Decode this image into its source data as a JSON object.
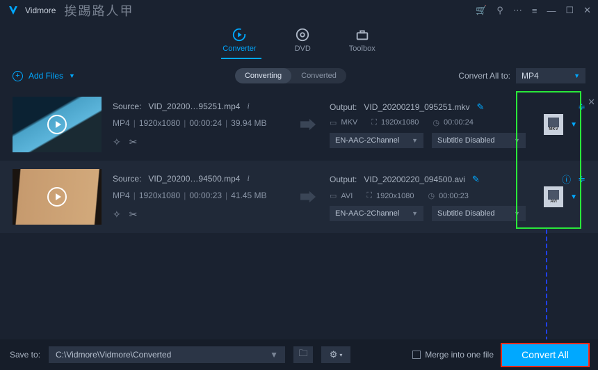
{
  "app": {
    "name": "Vidmore",
    "watermark": "挨踢路人甲"
  },
  "tabs": {
    "converter": "Converter",
    "dvd": "DVD",
    "toolbox": "Toolbox"
  },
  "toolbar": {
    "add_files": "Add Files",
    "seg_converting": "Converting",
    "seg_converted": "Converted",
    "convert_all_to": "Convert All to:",
    "convert_all_to_value": "MP4"
  },
  "items": [
    {
      "source_prefix": "Source:",
      "source_name": "VID_20200…95251.mp4",
      "format": "MP4",
      "resolution": "1920x1080",
      "duration": "00:00:24",
      "size": "39.94 MB",
      "output_prefix": "Output:",
      "output_name": "VID_20200219_095251.mkv",
      "out_container": "MKV",
      "out_resolution": "1920x1080",
      "out_duration": "00:00:24",
      "audio": "EN-AAC-2Channel",
      "subtitle": "Subtitle Disabled",
      "badge": "MKV"
    },
    {
      "source_prefix": "Source:",
      "source_name": "VID_20200…94500.mp4",
      "format": "MP4",
      "resolution": "1920x1080",
      "duration": "00:00:23",
      "size": "41.45 MB",
      "output_prefix": "Output:",
      "output_name": "VID_20200220_094500.avi",
      "out_container": "AVI",
      "out_resolution": "1920x1080",
      "out_duration": "00:00:23",
      "audio": "EN-AAC-2Channel",
      "subtitle": "Subtitle Disabled",
      "badge": "AVI"
    }
  ],
  "bottom": {
    "save_to": "Save to:",
    "path": "C:\\Vidmore\\Vidmore\\Converted",
    "merge": "Merge into one file",
    "convert_all": "Convert All"
  }
}
